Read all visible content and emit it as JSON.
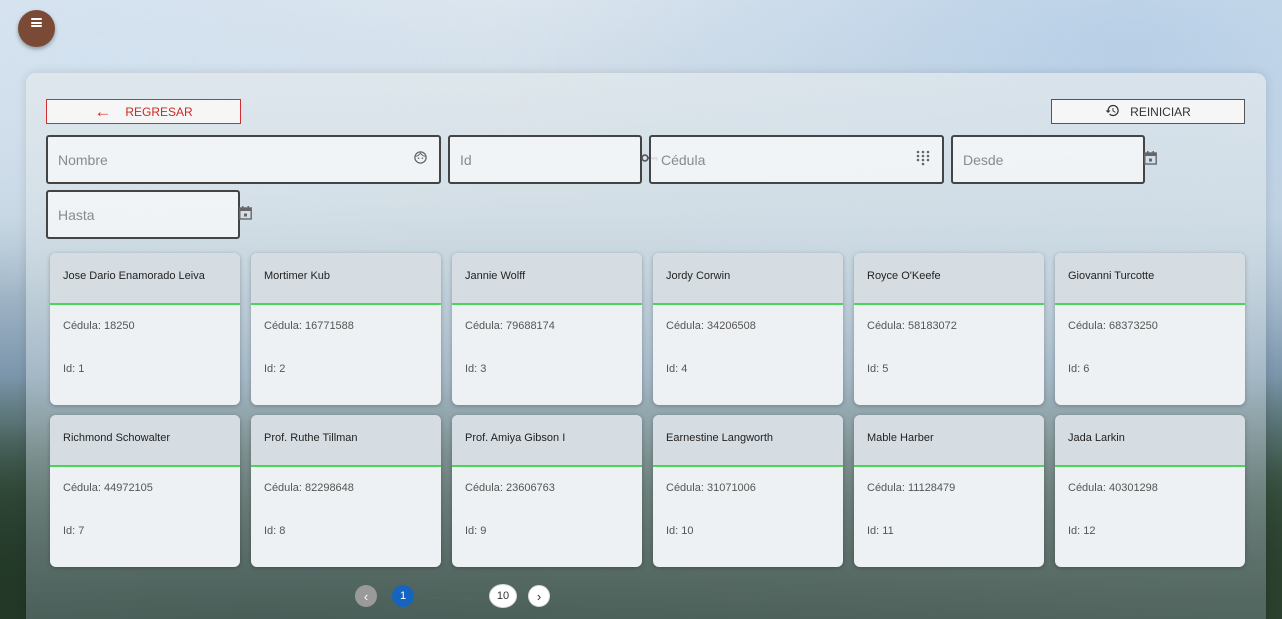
{
  "toolbar": {
    "back_label": "REGRESAR",
    "reset_label": "REINICIAR"
  },
  "filters": {
    "nombre_placeholder": "Nombre",
    "id_placeholder": "Id",
    "cedula_placeholder": "Cédula",
    "desde_placeholder": "Desde",
    "hasta_placeholder": "Hasta",
    "nombre_icon": "face-icon",
    "id_icon": "key-icon",
    "cedula_icon": "dialpad-icon",
    "desde_icon": "calendar-icon",
    "hasta_icon": "calendar-icon"
  },
  "cards": [
    {
      "name": "Jose Dario Enamorado Leiva",
      "cedula": "Cédula: 18250",
      "id": "Id: 1"
    },
    {
      "name": "Mortimer Kub",
      "cedula": "Cédula: 16771588",
      "id": "Id: 2"
    },
    {
      "name": "Jannie Wolff",
      "cedula": "Cédula: 79688174",
      "id": "Id: 3"
    },
    {
      "name": "Jordy Corwin",
      "cedula": "Cédula: 34206508",
      "id": "Id: 4"
    },
    {
      "name": "Royce O'Keefe",
      "cedula": "Cédula: 58183072",
      "id": "Id: 5"
    },
    {
      "name": "Giovanni Turcotte",
      "cedula": "Cédula: 68373250",
      "id": "Id: 6"
    },
    {
      "name": "Richmond Schowalter",
      "cedula": "Cédula: 44972105",
      "id": "Id: 7"
    },
    {
      "name": "Prof. Ruthe Tillman",
      "cedula": "Cédula: 82298648",
      "id": "Id: 8"
    },
    {
      "name": "Prof. Amiya Gibson I",
      "cedula": "Cédula: 23606763",
      "id": "Id: 9"
    },
    {
      "name": "Earnestine Langworth",
      "cedula": "Cédula: 31071006",
      "id": "Id: 10"
    },
    {
      "name": "Mable Harber",
      "cedula": "Cédula: 11128479",
      "id": "Id: 11"
    },
    {
      "name": "Jada Larkin",
      "cedula": "Cédula: 40301298",
      "id": "Id: 12"
    }
  ],
  "pagination": {
    "current": "1",
    "ellipsis": "...",
    "last": "10",
    "prev_icon": "chevron-left-icon",
    "next_icon": "chevron-right-icon"
  },
  "colors": {
    "accent_green": "#4cd35a",
    "back_red": "#cc2a22",
    "active_page": "#1565c0",
    "menu_fab": "#7a4a36"
  }
}
